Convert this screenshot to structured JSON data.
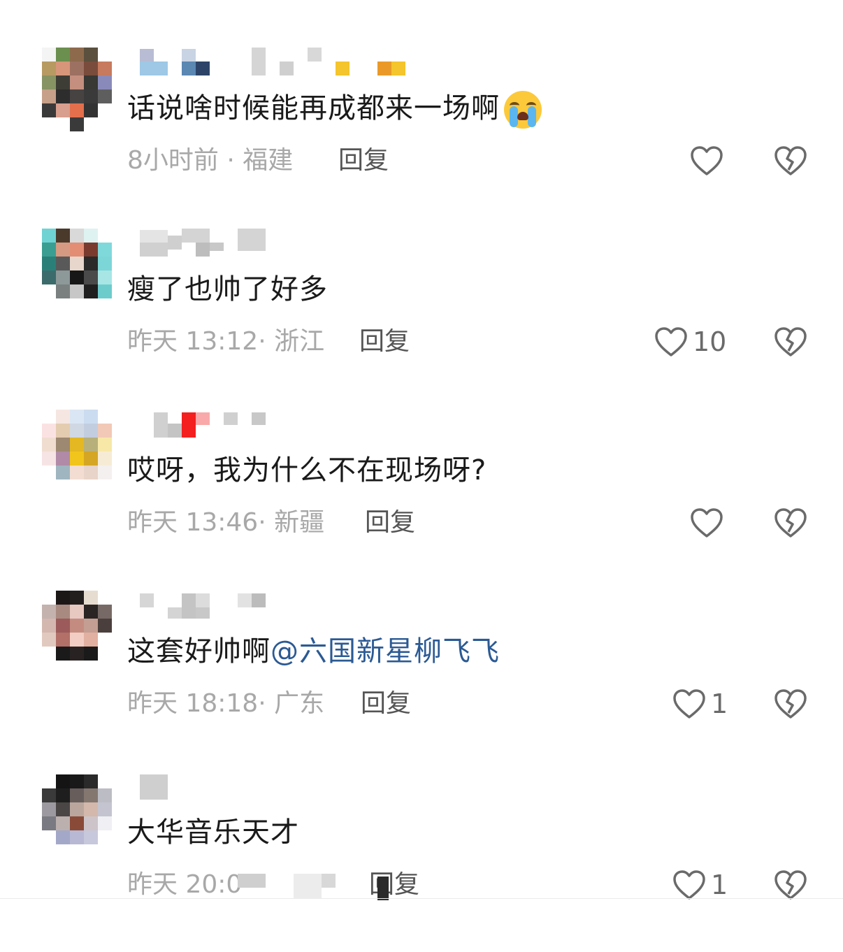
{
  "comments": [
    {
      "text": "话说啥时候能再成都来一场啊",
      "emoji": "crying-face",
      "time": "8小时前",
      "location": "福建",
      "reply_label": "回复",
      "like_count": ""
    },
    {
      "text": "瘦了也帅了好多",
      "time": "昨天 13:12",
      "location": "浙江",
      "reply_label": "回复",
      "like_count": "10"
    },
    {
      "text": "哎呀，我为什么不在现场呀?",
      "time": "昨天 13:46",
      "location": "新疆",
      "reply_label": "回复",
      "like_count": ""
    },
    {
      "text": "这套好帅啊",
      "mention": "@六国新星柳飞飞",
      "time": "昨天 18:18",
      "location": "广东",
      "reply_label": "回复",
      "like_count": "1"
    },
    {
      "text": "大华音乐天才",
      "time": "昨天 20:0",
      "location": "",
      "reply_label": "回复",
      "like_count": "1"
    }
  ],
  "separator": "·",
  "icons": {
    "like": "heart-outline-icon",
    "dislike": "broken-heart-icon"
  },
  "colors": {
    "text": "#1a1a1a",
    "meta": "#a8a8a8",
    "mention": "#2b5a94",
    "icon": "#6a6a6a"
  }
}
